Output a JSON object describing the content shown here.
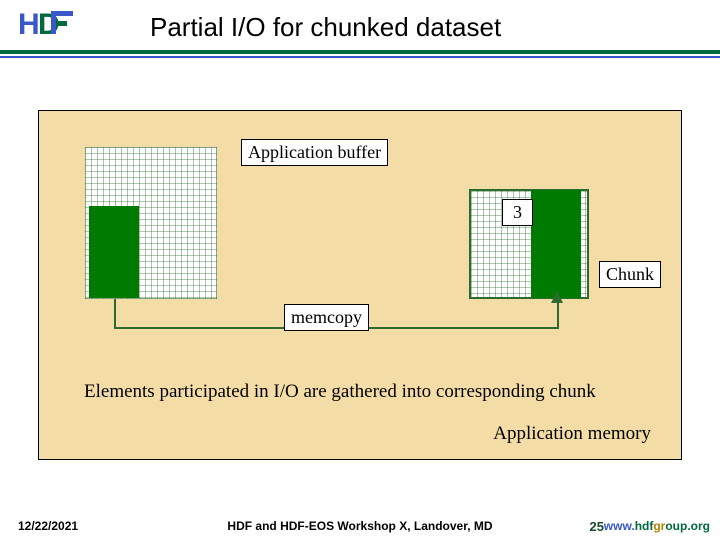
{
  "header": {
    "logo_text_h": "H",
    "logo_text_df": "DF",
    "title": "Partial I/O for chunked dataset"
  },
  "diagram": {
    "app_buffer_label": "Application buffer",
    "chunk_number": "3",
    "chunk_label": "Chunk",
    "memcopy_label": "memcopy",
    "caption": "Elements participated in I/O are gathered into corresponding chunk",
    "app_memory_label": "Application memory",
    "colors": {
      "frame_bg": "#f3dca6",
      "chunk_fill": "#007a00",
      "connector": "#2d6a2d"
    },
    "grids": {
      "left": {
        "cols": 22,
        "rows": 25
      },
      "right": {
        "cols": 20,
        "rows": 18
      }
    }
  },
  "footer": {
    "date": "12/22/2021",
    "venue": "HDF and HDF-EOS Workshop X, Landover, MD",
    "page": "25",
    "url_prefix": "www.",
    "url_mid_h": "hdf",
    "url_mid_g": "gr",
    "url_suffix": "oup.org"
  }
}
